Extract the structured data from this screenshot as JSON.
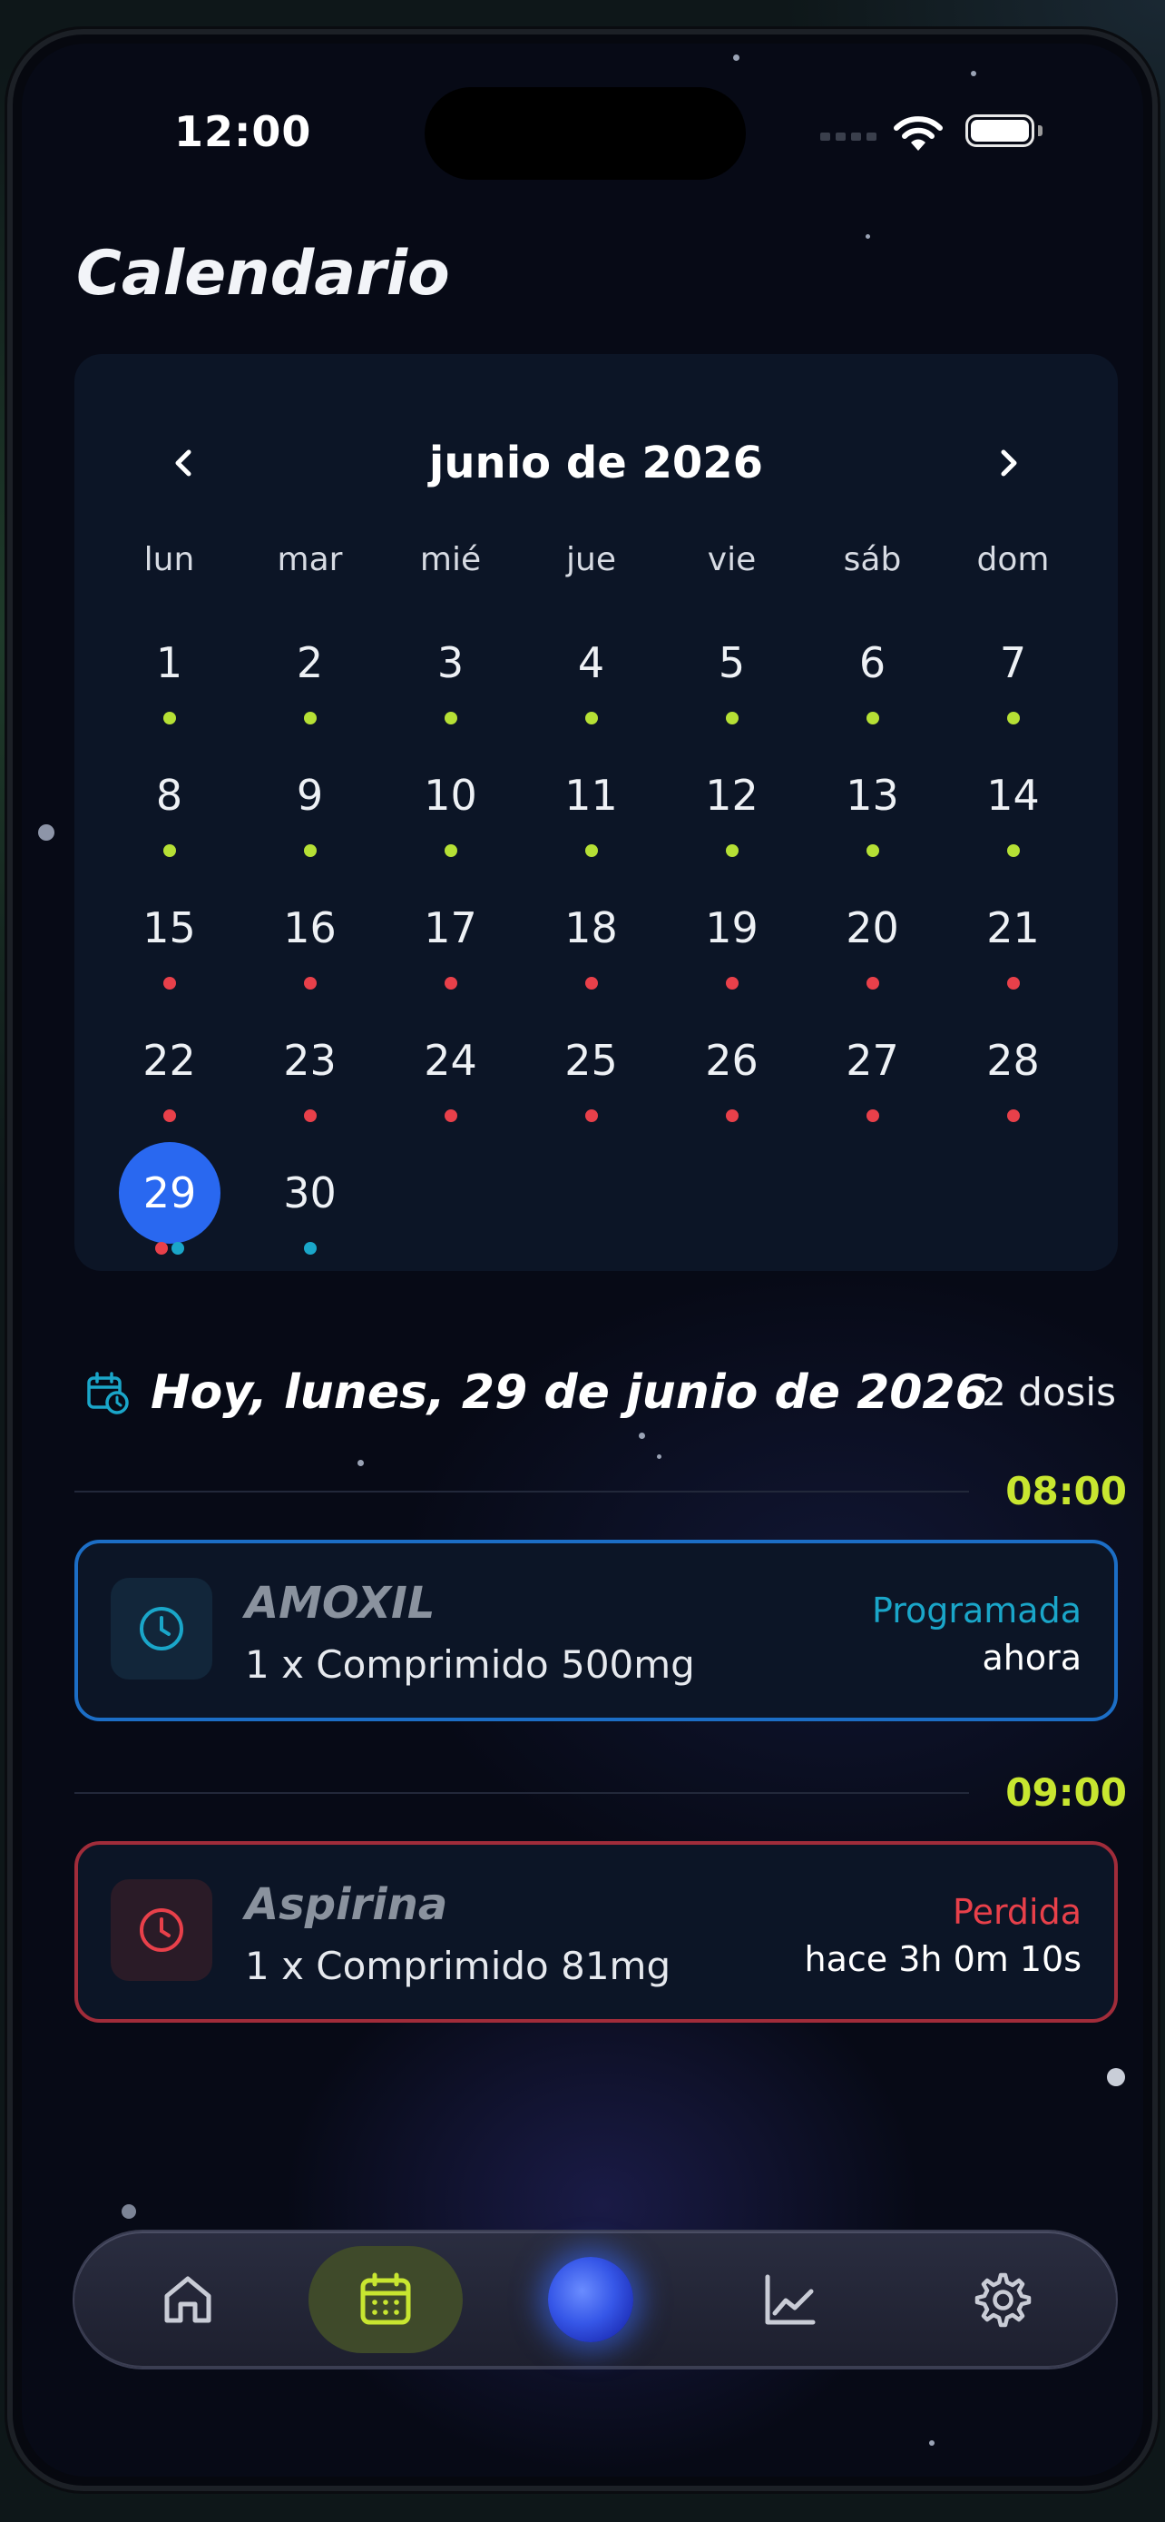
{
  "status_bar": {
    "time": "12:00"
  },
  "page_title": "Calendario",
  "calendar": {
    "month_label": "junio de 2026",
    "prev_icon": "chevron-left-icon",
    "next_icon": "chevron-right-icon",
    "weekdays": [
      "lun",
      "mar",
      "mié",
      "jue",
      "vie",
      "sáb",
      "dom"
    ],
    "selected_day": "29",
    "days": [
      {
        "n": "1",
        "dots": [
          "green"
        ]
      },
      {
        "n": "2",
        "dots": [
          "green"
        ]
      },
      {
        "n": "3",
        "dots": [
          "green"
        ]
      },
      {
        "n": "4",
        "dots": [
          "green"
        ]
      },
      {
        "n": "5",
        "dots": [
          "green"
        ]
      },
      {
        "n": "6",
        "dots": [
          "green"
        ]
      },
      {
        "n": "7",
        "dots": [
          "green"
        ]
      },
      {
        "n": "8",
        "dots": [
          "green"
        ]
      },
      {
        "n": "9",
        "dots": [
          "green"
        ]
      },
      {
        "n": "10",
        "dots": [
          "green"
        ]
      },
      {
        "n": "11",
        "dots": [
          "green"
        ]
      },
      {
        "n": "12",
        "dots": [
          "green"
        ]
      },
      {
        "n": "13",
        "dots": [
          "green"
        ]
      },
      {
        "n": "14",
        "dots": [
          "green"
        ]
      },
      {
        "n": "15",
        "dots": [
          "red"
        ]
      },
      {
        "n": "16",
        "dots": [
          "red"
        ]
      },
      {
        "n": "17",
        "dots": [
          "red"
        ]
      },
      {
        "n": "18",
        "dots": [
          "red"
        ]
      },
      {
        "n": "19",
        "dots": [
          "red"
        ]
      },
      {
        "n": "20",
        "dots": [
          "red"
        ]
      },
      {
        "n": "21",
        "dots": [
          "red"
        ]
      },
      {
        "n": "22",
        "dots": [
          "red"
        ]
      },
      {
        "n": "23",
        "dots": [
          "red"
        ]
      },
      {
        "n": "24",
        "dots": [
          "red"
        ]
      },
      {
        "n": "25",
        "dots": [
          "red"
        ]
      },
      {
        "n": "26",
        "dots": [
          "red"
        ]
      },
      {
        "n": "27",
        "dots": [
          "red"
        ]
      },
      {
        "n": "28",
        "dots": [
          "red"
        ]
      },
      {
        "n": "29",
        "dots": [
          "red",
          "teal"
        ]
      },
      {
        "n": "30",
        "dots": [
          "teal"
        ]
      }
    ],
    "dot_colors": {
      "green": "#b6e035",
      "red": "#e8404a",
      "teal": "#1aa6c9"
    }
  },
  "today": {
    "icon": "calendar-clock-icon",
    "title": "Hoy, lunes, 29 de junio de 2026",
    "count": "2 dosis"
  },
  "schedule": [
    {
      "time": "08:00",
      "name": "AMOXIL",
      "detail": "1 x Comprimido 500mg",
      "status": "Programada",
      "when": "ahora",
      "status_color": "#1aa6c9",
      "icon": "clock-icon"
    },
    {
      "time": "09:00",
      "name": "Aspirina",
      "detail": "1 x Comprimido 81mg",
      "status": "Perdida",
      "when": "hace 3h 0m 10s",
      "status_color": "#e8404a",
      "icon": "clock-icon"
    }
  ],
  "tabbar": {
    "items": [
      "home-icon",
      "calendar-icon",
      "orb-icon",
      "chart-icon",
      "gear-icon"
    ],
    "active": "calendar-icon",
    "active_color": "#c8e630"
  }
}
